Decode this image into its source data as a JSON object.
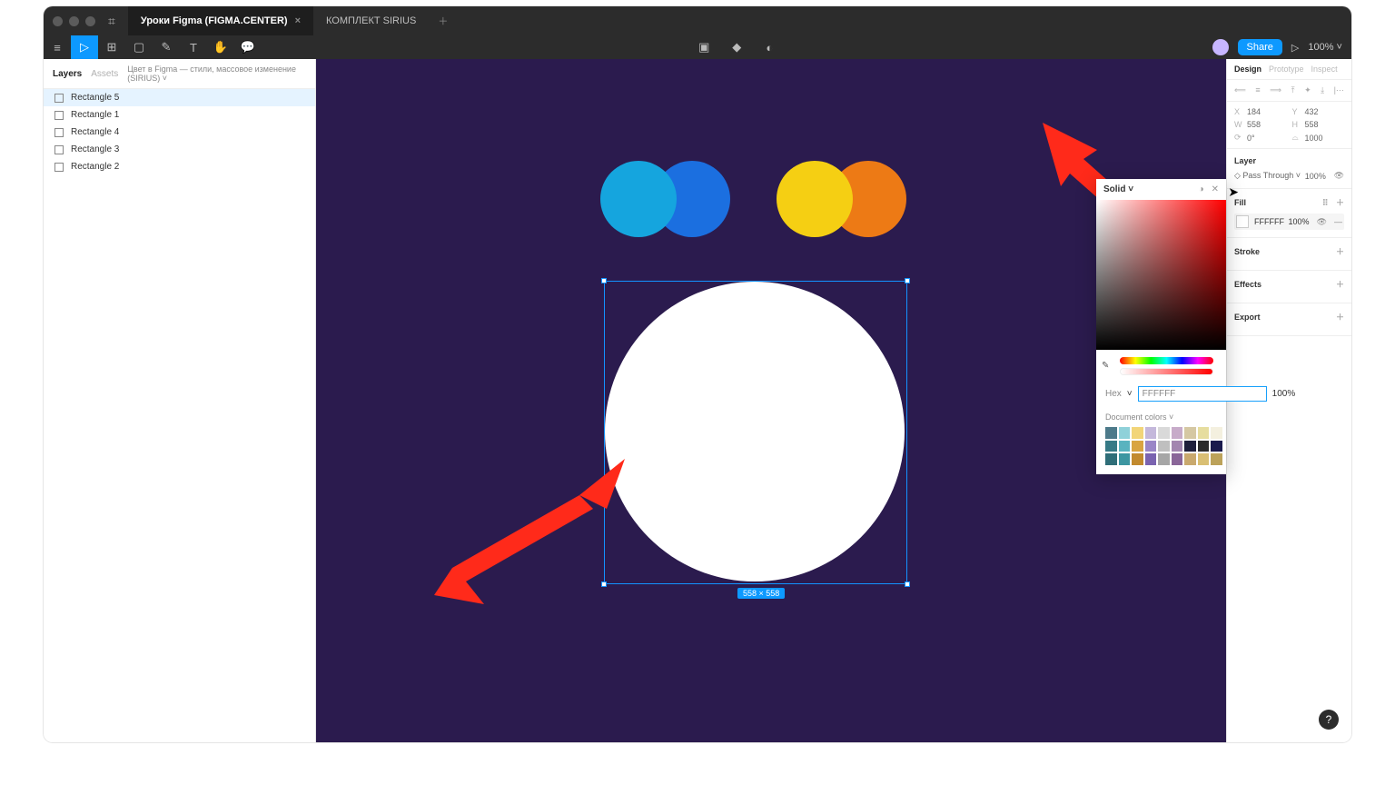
{
  "tabs": {
    "active": "Уроки Figma (FIGMA.CENTER)",
    "other": "КОМПЛЕКТ SIRIUS"
  },
  "toolbar": {
    "share": "Share",
    "zoom": "100%"
  },
  "left": {
    "tab_layers": "Layers",
    "tab_assets": "Assets",
    "page_name": "Цвет в Figma — стили, массовое изменение (SIRIUS)",
    "layers": [
      "Rectangle 5",
      "Rectangle 1",
      "Rectangle 4",
      "Rectangle 3",
      "Rectangle 2"
    ]
  },
  "canvas": {
    "dim": "558 × 558"
  },
  "right": {
    "tab_design": "Design",
    "tab_proto": "Prototype",
    "tab_inspect": "Inspect",
    "x": "184",
    "y": "432",
    "w": "558",
    "h": "558",
    "rot": "0°",
    "rad": "1000",
    "layer_title": "Layer",
    "blend": "Pass Through",
    "blend_op": "100%",
    "fill_title": "Fill",
    "fill_hex": "FFFFFF",
    "fill_op": "100%",
    "stroke_title": "Stroke",
    "effects_title": "Effects",
    "export_title": "Export"
  },
  "picker": {
    "mode": "Solid",
    "hex_label": "Hex",
    "hex_value": "FFFFFF",
    "hex_op": "100%",
    "doc_title": "Document colors",
    "swatches": [
      "#4d7a8a",
      "#8fd1d9",
      "#f2d579",
      "#c4b8db",
      "#d9d9d9",
      "#c7abc9",
      "#d5c8a3",
      "#e6dd9f",
      "#f4f0df",
      "#367a86",
      "#5ab3bf",
      "#d9a441",
      "#9a86c7",
      "#bfbfbf",
      "#a386b0",
      "#1e1f3b",
      "#2b2b2b",
      "#1a1a4d",
      "#2f6e78",
      "#3d96a1",
      "#c28a2e",
      "#7a63b0",
      "#a6a6a6",
      "#8a6699",
      "#c9a96e",
      "#d9bf73",
      "#bca25a"
    ]
  }
}
